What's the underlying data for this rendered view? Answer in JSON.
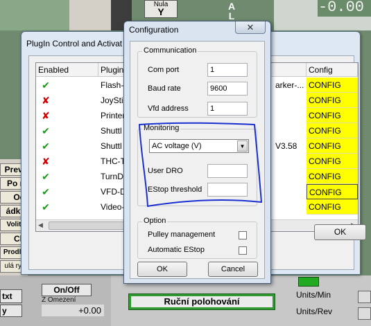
{
  "background": {
    "axis_letters": "A\nL\nL",
    "nula_label": "Nula",
    "nula_axis": "Y",
    "dro_value": "-0.00",
    "left_buttons": [
      "Previ",
      "Po n",
      "Od",
      "ádky",
      "Volite",
      "Ch",
      "Prodle",
      "ulá ryc"
    ],
    "txt_button": "txt",
    "y_button": "y",
    "onoff_button": "On/Off",
    "omezeni_label": "Z Omezení",
    "offset_value": "+0.00",
    "rucni_button": "Ruční polohování",
    "units_min": "Units/Min",
    "units_rev": "Units/Rev"
  },
  "plugin_window": {
    "title": "PlugIn Control and Activat",
    "columns": {
      "enabled": "Enabled",
      "plugin": "Plugin",
      "config": "Config"
    },
    "rows": [
      {
        "enabled": true,
        "name": "Flash-",
        "extra": "arker-...",
        "config": "CONFIG"
      },
      {
        "enabled": false,
        "name": "JoySti",
        "extra": "",
        "config": "CONFIG"
      },
      {
        "enabled": false,
        "name": "Printer",
        "extra": "",
        "config": "CONFIG"
      },
      {
        "enabled": true,
        "name": "Shuttl",
        "extra": "",
        "config": "CONFIG"
      },
      {
        "enabled": true,
        "name": "Shuttl",
        "extra": "V3.58",
        "config": "CONFIG"
      },
      {
        "enabled": false,
        "name": "THC-T",
        "extra": "",
        "config": "CONFIG"
      },
      {
        "enabled": true,
        "name": "TurnD",
        "extra": "",
        "config": "CONFIG"
      },
      {
        "enabled": true,
        "name": "VFD-D",
        "extra": "",
        "config": "CONFIG"
      },
      {
        "enabled": true,
        "name": "Video-",
        "extra": "",
        "config": "CONFIG"
      }
    ],
    "ok_label": "OK"
  },
  "config_dialog": {
    "title": "Configuration",
    "close_glyph": "✕",
    "communication": {
      "title": "Communication",
      "com_port_label": "Com port",
      "com_port_value": "1",
      "baud_rate_label": "Baud rate",
      "baud_rate_value": "9600",
      "vfd_address_label": "Vfd address",
      "vfd_address_value": "1"
    },
    "monitoring": {
      "title": "Monitoring",
      "selected": "AC voltage (V)",
      "user_dro_label": "User DRO",
      "user_dro_value": "",
      "estop_threshold_label": "EStop threshold",
      "estop_threshold_value": ""
    },
    "option": {
      "title": "Option",
      "pulley_label": "Pulley management",
      "pulley_checked": false,
      "auto_estop_label": "Automatic EStop",
      "auto_estop_checked": false
    },
    "ok_label": "OK",
    "cancel_label": "Cancel"
  },
  "annotation_color": "#1a2fd0"
}
